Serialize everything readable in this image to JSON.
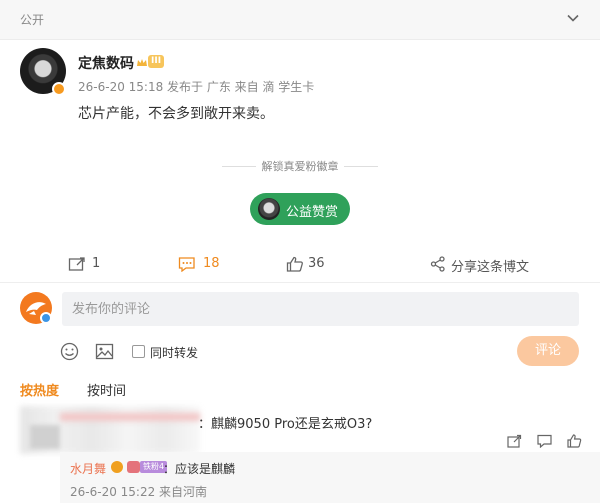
{
  "header": {
    "visibility": "公开"
  },
  "post": {
    "author": "定焦数码",
    "level_badge": "III",
    "meta": "26-6-20 15:18 发布于 广东 来自 滴 学生卡",
    "text": "芯片产能，不会多到敞开来卖。",
    "unlock_label": "解锁真爱粉徽章",
    "reward_button": "公益赞赏"
  },
  "actions": {
    "repost": {
      "count": "1",
      "icon": "repost-icon"
    },
    "comment": {
      "count": "18",
      "icon": "comment-icon",
      "active_color": "#ef8a1f"
    },
    "like": {
      "count": "36",
      "icon": "like-icon"
    },
    "share": {
      "label": "分享这条博文",
      "icon": "share-icon"
    }
  },
  "composer": {
    "placeholder": "发布你的评论",
    "repost_checkbox_label": "同时转发",
    "submit_label": "评论"
  },
  "sort": {
    "hot": "按热度",
    "time": "按时间"
  },
  "comments": [
    {
      "text": "：麒麟9050 Pro还是玄戒O3?",
      "reply": {
        "author": "水月舞",
        "badge": "铁粉4",
        "text": "：应该是麒麟",
        "meta": "26-6-20 15:22 来自河南"
      }
    }
  ],
  "colors": {
    "accent": "#ef8a1f",
    "reward_green": "#2fa15a",
    "submit_disabled": "#fbc89f",
    "reply_name": "#eb7350"
  }
}
